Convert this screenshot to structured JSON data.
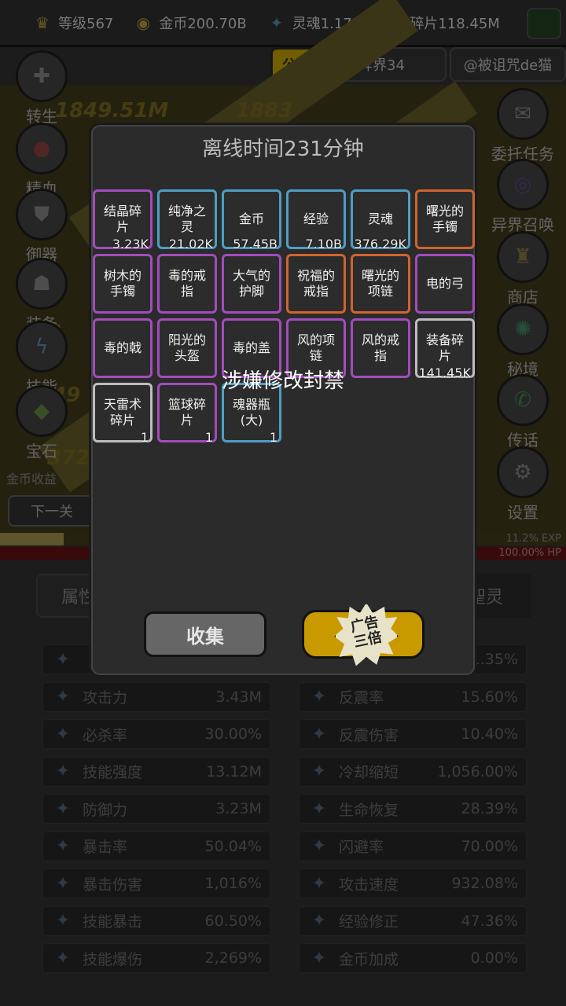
{
  "topbar": {
    "level": "等级567",
    "gold": "金币200.70B",
    "soul": "灵魂1.17M",
    "shards": "碎片118.45M"
  },
  "row2": {
    "notice": "公告",
    "otherworld": "异界34",
    "username": "@被诅咒de猫"
  },
  "left_menu": [
    "转生",
    "精血",
    "御器",
    "装备",
    "技能",
    "宝石"
  ],
  "right_menu": [
    "委托任务",
    "异界召唤",
    "商店",
    "秘境",
    "传话",
    "设置"
  ],
  "scene": {
    "damage_numbers": [
      "1849.51M",
      "1883",
      "3",
      "1849",
      "3728"
    ],
    "gold_income_label": "金币收益",
    "next_level": "下一关"
  },
  "bars": {
    "exp_text": "11.2% EXP",
    "exp_fraction": 0.112,
    "hp_text": "100.00% HP",
    "hp_fraction": 1.0
  },
  "tabs": {
    "left": "属性",
    "right": "聖灵"
  },
  "stats_left": [
    {
      "label": "",
      "value": "",
      "icon": "sword-icon"
    },
    {
      "label": "攻击力",
      "value": "3.43M",
      "icon": "sword-icon"
    },
    {
      "label": "必杀率",
      "value": "30.00%",
      "icon": "claw-icon"
    },
    {
      "label": "技能强度",
      "value": "13.12M",
      "icon": "bolt-icon"
    },
    {
      "label": "防御力",
      "value": "3.23M",
      "icon": "shield-icon"
    },
    {
      "label": "暴击率",
      "value": "50.04%",
      "icon": "flame-icon"
    },
    {
      "label": "暴击伤害",
      "value": "1,016%",
      "icon": "flame-icon"
    },
    {
      "label": "技能暴击",
      "value": "60.50%",
      "icon": "blue-flame-icon"
    },
    {
      "label": "技能爆伤",
      "value": "2,269%",
      "icon": "blue-flame-icon"
    }
  ],
  "stats_right": [
    {
      "label": "",
      "value": "1.35%",
      "icon": "thorn-icon"
    },
    {
      "label": "反震率",
      "value": "15.60%",
      "icon": "thorn-icon"
    },
    {
      "label": "反震伤害",
      "value": "10.40%",
      "icon": "thorn-icon"
    },
    {
      "label": "冷却缩短",
      "value": "1,056.00%",
      "icon": "cooldown-icon"
    },
    {
      "label": "生命恢复",
      "value": "28.39%",
      "icon": "heal-icon"
    },
    {
      "label": "闪避率",
      "value": "70.00%",
      "icon": "boot-icon"
    },
    {
      "label": "攻击速度",
      "value": "932.08%",
      "icon": "swords-icon"
    },
    {
      "label": "经验修正",
      "value": "47.36%",
      "icon": "crown-icon"
    },
    {
      "label": "金币加成",
      "value": "0.00%",
      "icon": "coin-icon"
    }
  ],
  "dialog": {
    "title": "离线时间231分钟",
    "ban_text": "涉嫌修改封禁",
    "collect": "收集",
    "ad_button": "广告\n三倍",
    "items": [
      {
        "name": "结晶碎片",
        "count": "3.23K",
        "quality": "purple"
      },
      {
        "name": "纯净之灵",
        "count": "21.02K",
        "quality": "blue"
      },
      {
        "name": "金币",
        "count": "57.45B",
        "quality": "blue"
      },
      {
        "name": "经验",
        "count": "7.10B",
        "quality": "blue"
      },
      {
        "name": "灵魂",
        "count": "376.29K",
        "quality": "blue"
      },
      {
        "name": "曙光的手镯",
        "count": "",
        "quality": "orange"
      },
      {
        "name": "树木的手镯",
        "count": "",
        "quality": "purple"
      },
      {
        "name": "毒的戒指",
        "count": "",
        "quality": "purple"
      },
      {
        "name": "大气的护脚",
        "count": "",
        "quality": "purple"
      },
      {
        "name": "祝福的戒指",
        "count": "",
        "quality": "orange"
      },
      {
        "name": "曙光的项链",
        "count": "",
        "quality": "orange"
      },
      {
        "name": "电的弓",
        "count": "",
        "quality": "purple"
      },
      {
        "name": "毒的戟",
        "count": "",
        "quality": "purple"
      },
      {
        "name": "阳光的头盔",
        "count": "",
        "quality": "purple"
      },
      {
        "name": "毒的盖",
        "count": "",
        "quality": "purple"
      },
      {
        "name": "风的项链",
        "count": "",
        "quality": "purple"
      },
      {
        "name": "风的戒指",
        "count": "",
        "quality": "purple"
      },
      {
        "name": "装备碎片",
        "count": "141.45K",
        "quality": "grey"
      },
      {
        "name": "天雷术碎片",
        "count": "1",
        "quality": "grey"
      },
      {
        "name": "篮球碎片",
        "count": "1",
        "quality": "purple"
      },
      {
        "name": "魂器瓶(大)",
        "count": "1",
        "quality": "blue"
      }
    ]
  }
}
